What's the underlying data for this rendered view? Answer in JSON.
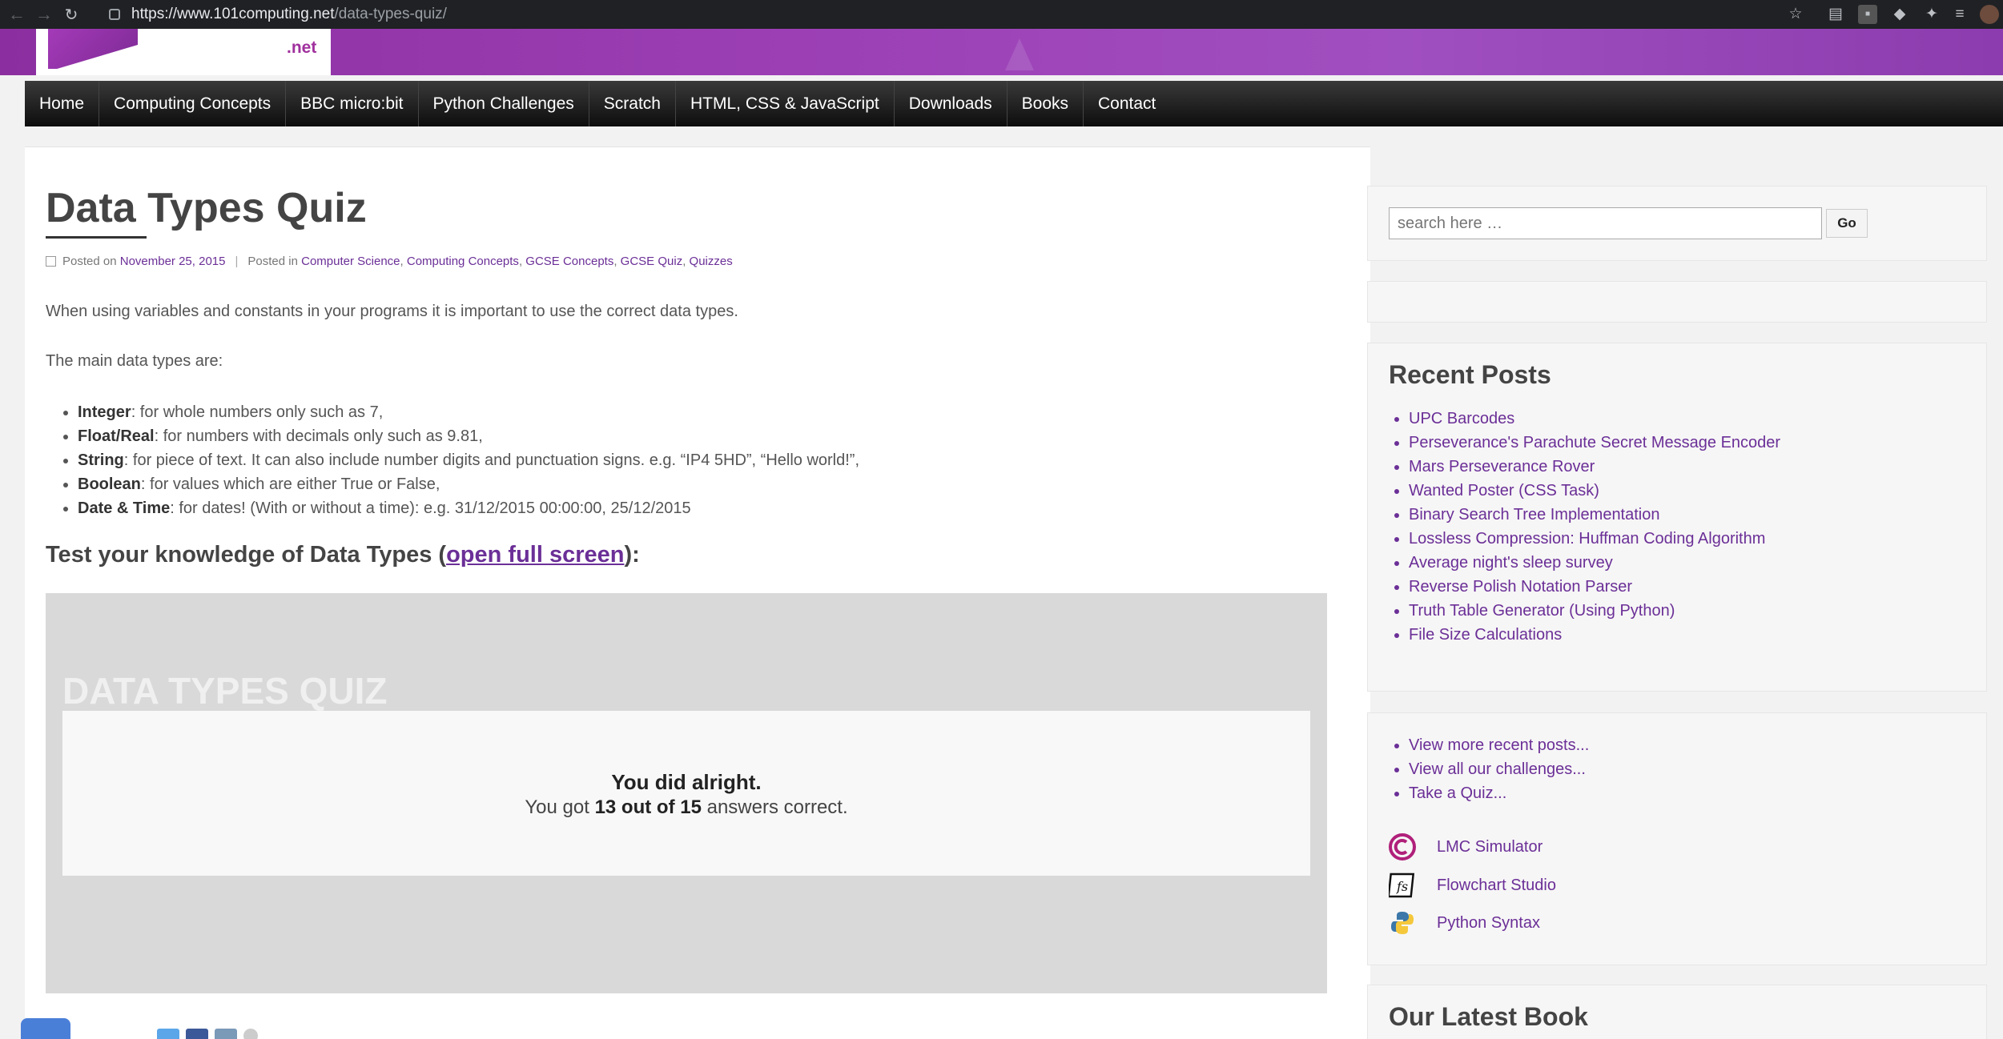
{
  "browser": {
    "url_host": "https://www.101computing.net",
    "url_path": "/data-types-quiz/"
  },
  "logo": {
    "suffix": ".net"
  },
  "nav": [
    "Home",
    "Computing Concepts",
    "BBC micro:bit",
    "Python Challenges",
    "Scratch",
    "HTML, CSS & JavaScript",
    "Downloads",
    "Books",
    "Contact"
  ],
  "article": {
    "title": "Data Types Quiz",
    "posted_on_label": "Posted on",
    "date": "November 25, 2015",
    "posted_in_label": "Posted in",
    "categories": [
      "Computer Science",
      "Computing Concepts",
      "GCSE Concepts",
      "GCSE Quiz",
      "Quizzes"
    ],
    "intro": "When using variables and constants in your programs it is important to use the correct data types.",
    "main_types": "The main data types are:",
    "types": [
      {
        "name": "Integer",
        "desc": ": for whole numbers only such as 7,"
      },
      {
        "name": "Float/Real",
        "desc": ": for numbers with decimals only such as 9.81,"
      },
      {
        "name": "String",
        "desc": ": for piece of text. It can also include number digits and punctuation signs. e.g. “IP4 5HD”, “Hello world!”,"
      },
      {
        "name": "Boolean",
        "desc": ": for values which are either True or False,"
      },
      {
        "name": "Date & Time",
        "desc": ": for dates! (With or without a time): e.g. 31/12/2015 00:00:00, 25/12/2015"
      }
    ],
    "test_prefix": "Test your knowledge of Data Types (",
    "test_link": "open full screen",
    "test_suffix": "):"
  },
  "quiz": {
    "title": "DATA TYPES QUIZ",
    "result_heading": "You did alright.",
    "result_prefix": "You got ",
    "result_score": "13 out of 15",
    "result_suffix": " answers correct."
  },
  "sidebar": {
    "search_placeholder": "search here …",
    "go_label": "Go",
    "recent_title": "Recent Posts",
    "recent_posts": [
      "UPC Barcodes",
      "Perseverance's Parachute Secret Message Encoder",
      "Mars Perseverance Rover",
      "Wanted Poster (CSS Task)",
      "Binary Search Tree Implementation",
      "Lossless Compression: Huffman Coding Algorithm",
      "Average night's sleep survey",
      "Reverse Polish Notation Parser",
      "Truth Table Generator (Using Python)",
      "File Size Calculations"
    ],
    "more_links": [
      "View more recent posts...",
      "View all our challenges...",
      "Take a Quiz..."
    ],
    "tools": [
      {
        "label": "LMC Simulator",
        "icon": "lmc-icon"
      },
      {
        "label": "Flowchart Studio",
        "icon": "flowchart-icon"
      },
      {
        "label": "Python Syntax",
        "icon": "python-icon"
      }
    ],
    "book_title": "Our Latest Book"
  }
}
